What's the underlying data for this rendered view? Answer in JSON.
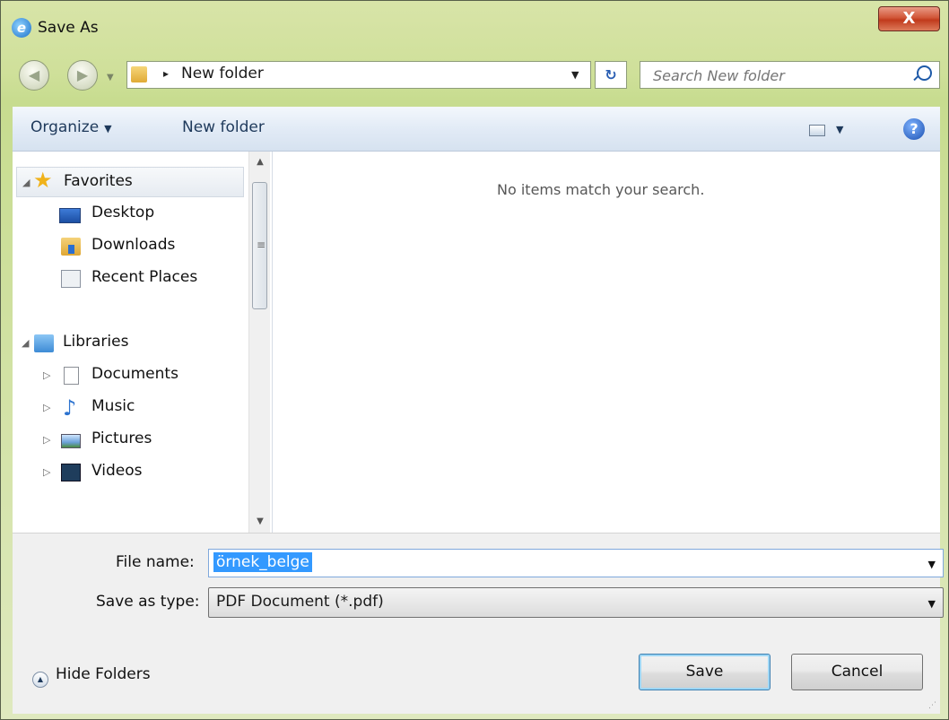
{
  "window": {
    "title": "Save As",
    "close_glyph": "X"
  },
  "nav": {
    "back_icon": "back-arrow-icon",
    "forward_icon": "forward-arrow-icon"
  },
  "address": {
    "path_separator": "▸",
    "folder": "New folder"
  },
  "search": {
    "placeholder": "Search New folder"
  },
  "toolbar": {
    "organize_label": "Organize",
    "new_folder_label": "New folder",
    "help_glyph": "?"
  },
  "sidebar": {
    "favorites": {
      "label": "Favorites",
      "items": [
        {
          "label": "Desktop",
          "icon": "desktop-icon"
        },
        {
          "label": "Downloads",
          "icon": "downloads-folder-icon"
        },
        {
          "label": "Recent Places",
          "icon": "recent-places-icon"
        }
      ]
    },
    "libraries": {
      "label": "Libraries",
      "items": [
        {
          "label": "Documents",
          "icon": "documents-icon"
        },
        {
          "label": "Music",
          "icon": "music-icon"
        },
        {
          "label": "Pictures",
          "icon": "pictures-icon"
        },
        {
          "label": "Videos",
          "icon": "videos-icon"
        }
      ]
    }
  },
  "content": {
    "empty_message": "No items match your search."
  },
  "form": {
    "file_name_label": "File name:",
    "file_name_value": "örnek_belge",
    "save_type_label": "Save as type:",
    "save_type_value": "PDF Document (*.pdf)"
  },
  "footer": {
    "hide_folders_label": "Hide Folders",
    "save_label": "Save",
    "cancel_label": "Cancel"
  },
  "colors": {
    "selection": "#3399ff",
    "frame": "#cfe09a",
    "toolbar": "#e2ebf6"
  }
}
